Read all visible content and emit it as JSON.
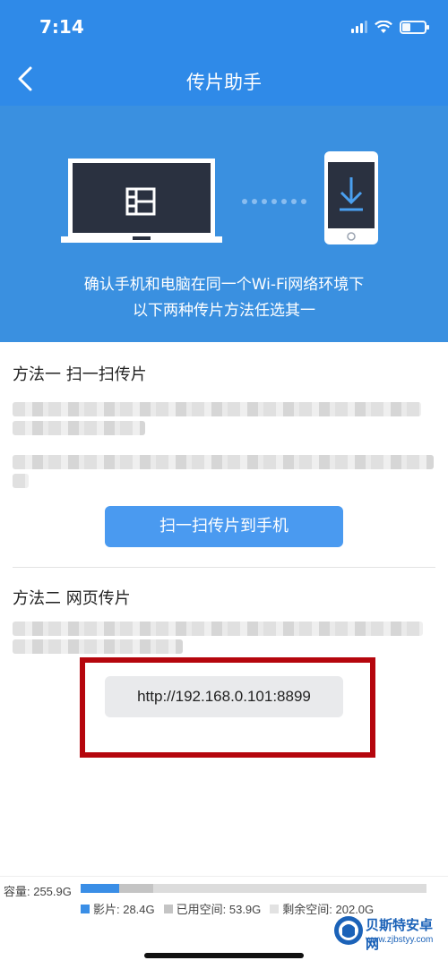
{
  "status_bar": {
    "time": "7:14"
  },
  "nav": {
    "title": "传片助手"
  },
  "hero": {
    "line1": "确认手机和电脑在同一个Wi-Fi网络环境下",
    "line2": "以下两种传片方法任选其一"
  },
  "method1": {
    "title": "方法一 扫一扫传片",
    "button_label": "扫一扫传片到手机"
  },
  "method2": {
    "title": "方法二 网页传片",
    "url": "http://192.168.0.101:8899"
  },
  "storage": {
    "capacity_label": "容量: 255.9G",
    "capacity_gb": 255.9,
    "legend": [
      {
        "label": "影片: 28.4G",
        "value_gb": 28.4,
        "color": "#3a8ee6"
      },
      {
        "label": "已用空间: 53.9G",
        "value_gb": 53.9,
        "color": "#c4c4c4"
      },
      {
        "label": "剩余空间: 202.0G",
        "value_gb": 202.0,
        "color": "#e2e2e2"
      }
    ]
  },
  "watermark": {
    "title": "贝斯特安卓网",
    "url": "www.zjbstyy.com"
  },
  "colors": {
    "brand_blue": "#2f8ae8",
    "highlight_red": "#b5060d"
  }
}
